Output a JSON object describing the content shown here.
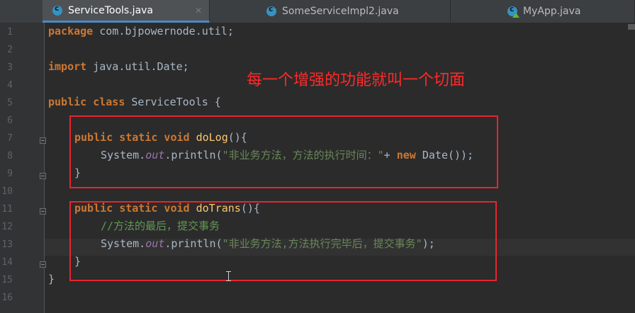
{
  "tabs": [
    {
      "label": "ServiceTools.java",
      "active": true,
      "icon": "java-class-icon"
    },
    {
      "label": "SomeServiceImpl2.java",
      "active": false,
      "icon": "java-class-icon"
    },
    {
      "label": "MyApp.java",
      "active": false,
      "icon": "java-app-class-icon"
    }
  ],
  "line_numbers": [
    "1",
    "2",
    "3",
    "4",
    "5",
    "6",
    "7",
    "8",
    "9",
    "10",
    "11",
    "12",
    "13",
    "14",
    "15",
    "16"
  ],
  "code": {
    "l1_kw": "package",
    "l1_rest": " com.bjpowernode.util;",
    "l3_kw": "import",
    "l3_rest": " java.util.Date;",
    "l5_kw": "public class",
    "l5_rest": " ServiceTools {",
    "l7_kw": "public static void",
    "l7_name": " doLog",
    "l7_rest": "(){",
    "l8_a": "System.",
    "l8_out": "out",
    "l8_b": ".println(",
    "l8_str": "\"非业务方法，方法的执行时间：\"",
    "l8_plus": "+ ",
    "l8_new": "new",
    "l8_end": " Date());",
    "l9": "}",
    "l11_kw": "public static void",
    "l11_name": " doTrans",
    "l11_rest": "(){",
    "l12_cmt": "//方法的最后，提交事务",
    "l13_a": "System.",
    "l13_out": "out",
    "l13_b": ".println(",
    "l13_str": "\"非业务方法,方法执行完毕后，提交事务\"",
    "l13_end": ");",
    "l14": "}",
    "l15": "}"
  },
  "annotation": "每一个增强的功能就叫一个切面",
  "colors": {
    "keyword": "#cc7832",
    "string": "#6a8759",
    "comment": "#629755",
    "static_field": "#9876aa",
    "annotation_red": "#ff2a2a",
    "editor_bg": "#2b2b2b"
  }
}
